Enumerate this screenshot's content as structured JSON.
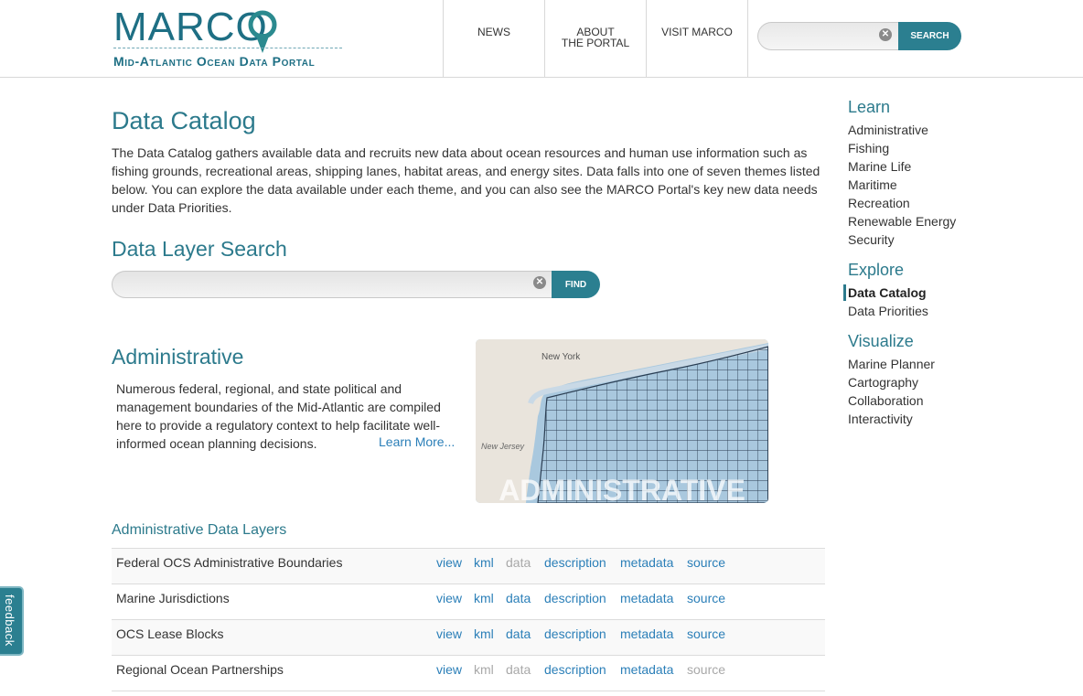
{
  "header": {
    "logo": {
      "wordmark": "MARCO",
      "subtitle": "Mid-Atlantic Ocean Data Portal"
    },
    "nav": [
      {
        "line1": "News",
        "line2": ""
      },
      {
        "line1": "About",
        "line2": "the Portal"
      },
      {
        "line1": "Visit MARCO",
        "line2": ""
      }
    ],
    "search": {
      "placeholder": "",
      "button_label": "Search",
      "clear_glyph": "✕"
    }
  },
  "main": {
    "title": "Data Catalog",
    "intro": "The Data Catalog gathers available data and recruits new data about ocean resources and human use information such as fishing grounds, recreational areas, shipping lanes, habitat areas, and energy sites. Data falls into one of seven themes listed below. You can explore the data available under each theme, and you can also see the MARCO Portal's key new data needs under Data Priorities.",
    "layer_search": {
      "title": "Data Layer Search",
      "placeholder": "",
      "button_label": "Find",
      "clear_glyph": "✕"
    },
    "theme": {
      "title": "Administrative",
      "description": "Numerous federal, regional, and state political and management boundaries of the Mid-Atlantic are compiled here to provide a regulatory context to help facilitate well-informed ocean planning decisions.",
      "learn_more": "Learn More...",
      "map": {
        "caption": "ADMINISTRATIVE",
        "label_city": "New York",
        "label_state": "New Jersey",
        "land_color": "#e9e4dc",
        "water_color": "#a9c8de",
        "grid_color": "#2a3d52"
      }
    },
    "layers_title": "Administrative Data Layers",
    "layers": [
      {
        "name": "Federal OCS Administrative Boundaries",
        "links": [
          "view",
          "kml",
          "data",
          "description",
          "metadata",
          "source"
        ],
        "disabled": [
          "data"
        ]
      },
      {
        "name": "Marine Jurisdictions",
        "links": [
          "view",
          "kml",
          "data",
          "description",
          "metadata",
          "source"
        ],
        "disabled": []
      },
      {
        "name": "OCS Lease Blocks",
        "links": [
          "view",
          "kml",
          "data",
          "description",
          "metadata",
          "source"
        ],
        "disabled": []
      },
      {
        "name": "Regional Ocean Partnerships",
        "links": [
          "view",
          "kml",
          "data",
          "description",
          "metadata",
          "source"
        ],
        "disabled": [
          "kml",
          "data",
          "source"
        ]
      }
    ]
  },
  "sidebar": {
    "sections": [
      {
        "title": "Learn",
        "items": [
          "Administrative",
          "Fishing",
          "Marine Life",
          "Maritime",
          "Recreation",
          "Renewable Energy",
          "Security"
        ]
      },
      {
        "title": "Explore",
        "items": [
          "Data Catalog",
          "Data Priorities"
        ],
        "active": "Data Catalog"
      },
      {
        "title": "Visualize",
        "items": [
          "Marine Planner",
          "Cartography",
          "Collaboration",
          "Interactivity"
        ]
      }
    ]
  },
  "feedback": {
    "label": "feedback"
  },
  "colors": {
    "accent": "#2c7a8c",
    "button": "#2b7f90",
    "link": "#2b7fb8",
    "disabled_link": "#a8a8a8"
  }
}
